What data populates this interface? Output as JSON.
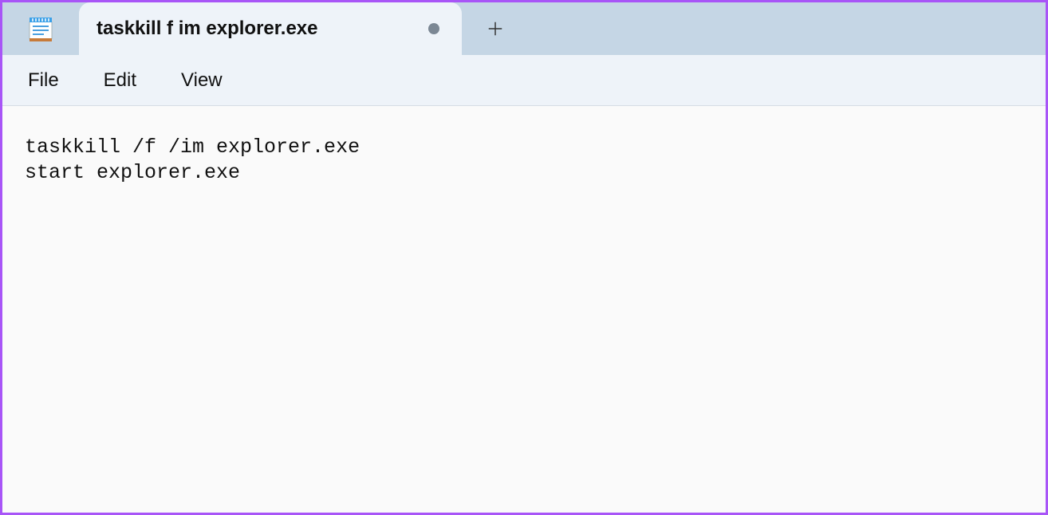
{
  "app": {
    "icon": "notepad-icon"
  },
  "tabs": [
    {
      "title": "taskkill f im explorer.exe",
      "dirty": true
    }
  ],
  "menubar": {
    "items": [
      "File",
      "Edit",
      "View"
    ]
  },
  "editor": {
    "content": "taskkill /f /im explorer.exe\nstart explorer.exe"
  }
}
